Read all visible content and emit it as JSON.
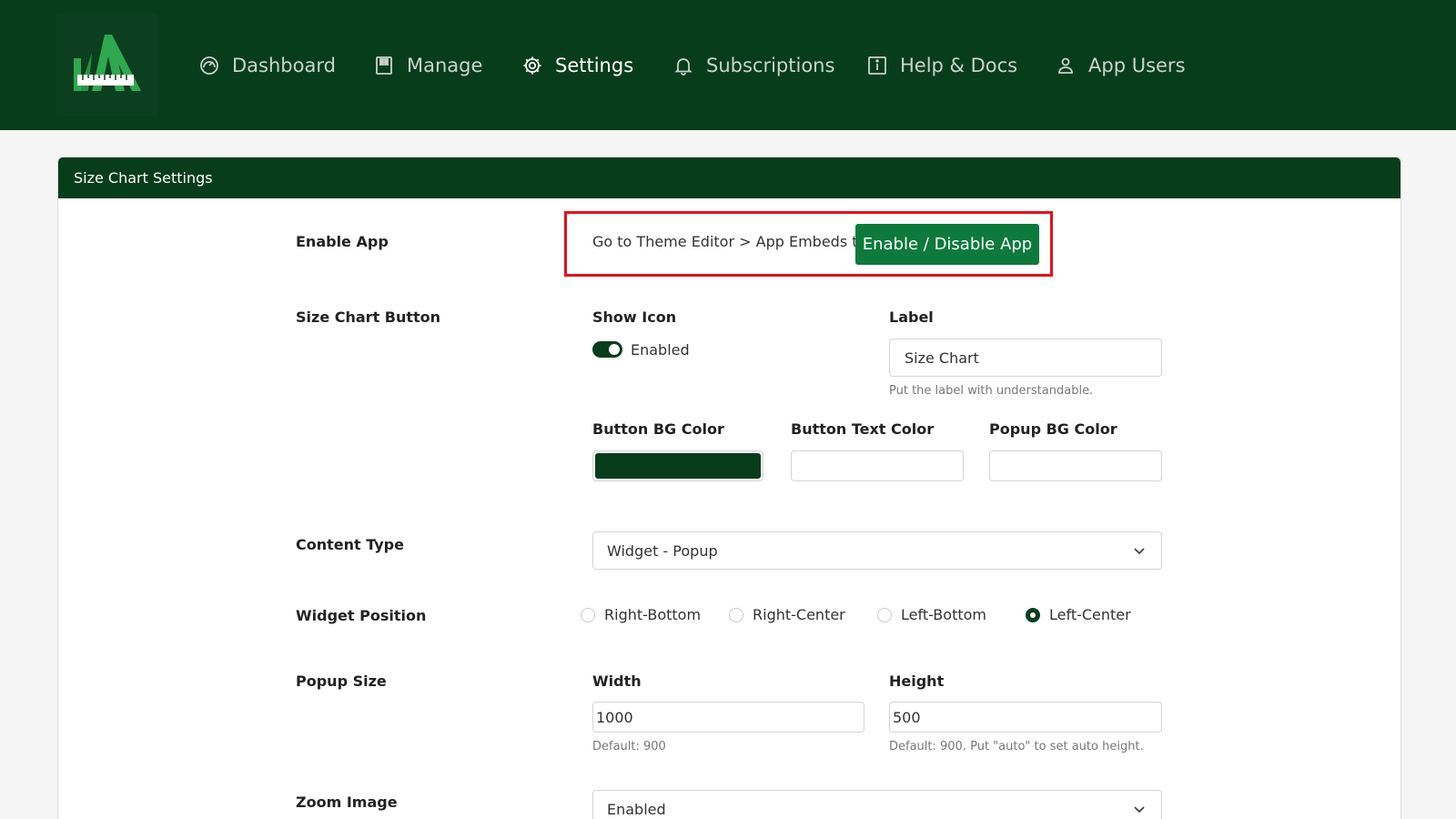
{
  "nav": {
    "items": [
      {
        "label": "Dashboard",
        "icon": "dashboard-gauge-icon",
        "active": false
      },
      {
        "label": "Manage",
        "icon": "manage-film-icon",
        "active": false
      },
      {
        "label": "Settings",
        "icon": "gear-icon",
        "active": true
      },
      {
        "label": "Subscriptions",
        "icon": "bell-icon",
        "active": false
      },
      {
        "label": "Help & Docs",
        "icon": "info-icon",
        "active": false
      },
      {
        "label": "App Users",
        "icon": "user-icon",
        "active": false
      }
    ]
  },
  "colors": {
    "brand_dark": "#083d1c",
    "button_green": "#0d7a3b",
    "highlight_red": "#e3101b"
  },
  "card": {
    "title": "Size Chart Settings"
  },
  "enable_app": {
    "label": "Enable App",
    "instruction": "Go to Theme Editor > App Embeds to",
    "button": "Enable / Disable App"
  },
  "size_chart_button": {
    "label": "Size Chart Button",
    "show_icon_label": "Show Icon",
    "show_icon_state": "Enabled",
    "label_field_label": "Label",
    "label_value": "Size Chart",
    "label_hint": "Put the label with understandable.",
    "button_bg_color_label": "Button BG Color",
    "button_bg_color": "#083d1c",
    "button_text_color_label": "Button Text Color",
    "button_text_color": "#ffffff",
    "popup_bg_color_label": "Popup BG Color",
    "popup_bg_color": "#ffffff"
  },
  "content_type": {
    "label": "Content Type",
    "value": "Widget - Popup"
  },
  "widget_position": {
    "label": "Widget Position",
    "options": [
      "Right-Bottom",
      "Right-Center",
      "Left-Bottom",
      "Left-Center"
    ],
    "selected": "Left-Center"
  },
  "popup_size": {
    "label": "Popup Size",
    "width_label": "Width",
    "width_value": "1000",
    "width_hint": "Default: 900",
    "height_label": "Height",
    "height_value": "500",
    "height_hint": "Default: 900. Put \"auto\" to set auto height."
  },
  "zoom_image": {
    "label": "Zoom Image",
    "value": "Enabled"
  }
}
